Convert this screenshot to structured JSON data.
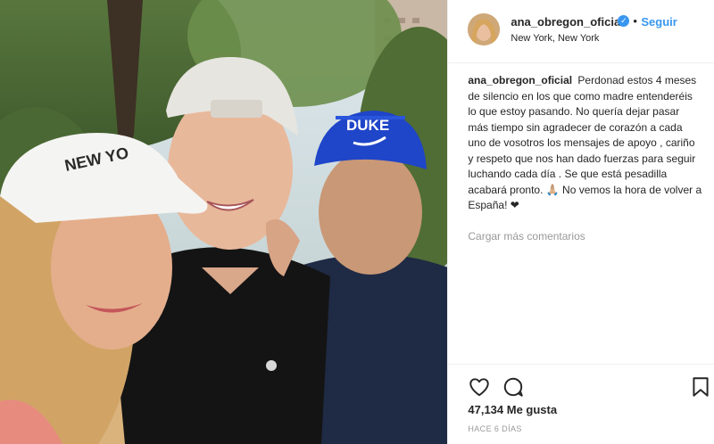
{
  "post": {
    "username": "ana_obregon_oficial",
    "follow_label": "Seguir",
    "dot": "•",
    "location": "New York, New York",
    "verified_mark": "✓",
    "caption_user": "ana_obregon_oficial",
    "caption_text": "Perdonad estos 4 meses de silencio en los que como madre entenderéis lo que estoy pasando. No quería dejar pasar más tiempo sin agradecer de corazón a cada uno de vosotros los mensajes de apoyo , cariño y respeto que nos han dado fuerzas para seguir luchando cada día . Se que está pesadilla acabará pronto. 🙏🏼 No vemos la hora de volver a España! ❤",
    "load_more": "Cargar más comentarios",
    "likes": "47,134 Me gusta",
    "time": "HACE 6 DÍAS",
    "photo": {
      "cap_left_text": "NEW YO",
      "cap_right_text": "DUKE"
    }
  },
  "icons": {
    "like": "heart-icon",
    "comment": "comment-icon",
    "save": "bookmark-icon",
    "verified": "verified-badge-icon"
  },
  "colors": {
    "link_blue": "#3897f0",
    "muted": "#999999",
    "text": "#262626",
    "border": "#efefef"
  }
}
